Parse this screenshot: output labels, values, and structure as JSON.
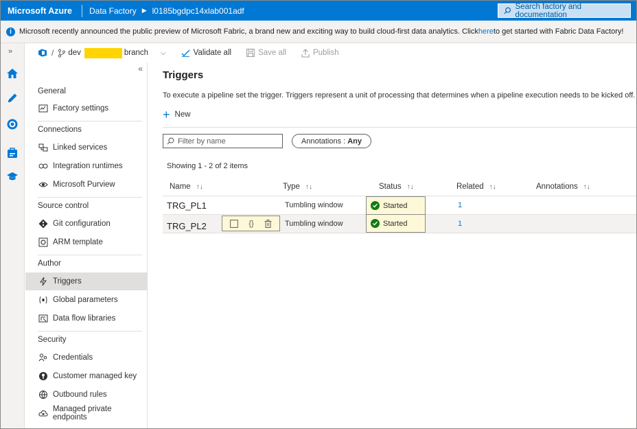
{
  "topbar": {
    "brand": "Microsoft Azure",
    "crumb_service": "Data Factory",
    "crumb_factory": "l0185bgdpc14xlab001adf",
    "search_placeholder": "Search factory and documentation"
  },
  "banner": {
    "text_before": "Microsoft recently announced the public preview of Microsoft Fabric, a brand new and exciting way to build cloud-first data analytics. Click ",
    "link": "here",
    "text_after": " to get started with Fabric Data Factory!"
  },
  "gitbar": {
    "slash": "/",
    "branch_prefix": "dev",
    "branch_suffix": "branch",
    "validate_all": "Validate all",
    "save_all": "Save all",
    "publish": "Publish"
  },
  "sidebar": {
    "sections": {
      "general": "General",
      "connections": "Connections",
      "source_control": "Source control",
      "author": "Author",
      "security": "Security"
    },
    "items": {
      "factory_settings": "Factory settings",
      "linked_services": "Linked services",
      "integration_runtimes": "Integration runtimes",
      "microsoft_purview": "Microsoft Purview",
      "git_configuration": "Git configuration",
      "arm_template": "ARM template",
      "triggers": "Triggers",
      "global_parameters": "Global parameters",
      "data_flow_libraries": "Data flow libraries",
      "credentials": "Credentials",
      "customer_managed_key": "Customer managed key",
      "outbound_rules": "Outbound rules",
      "managed_private_endpoints": "Managed private endpoints"
    }
  },
  "main": {
    "title": "Triggers",
    "description": "To execute a pipeline set the trigger. Triggers represent a unit of processing that determines when a pipeline execution needs to be kicked off.",
    "new_label": "New",
    "filter_placeholder": "Filter by name",
    "annotations_label": "Annotations :",
    "annotations_value": "Any",
    "showing": "Showing 1 - 2 of 2 items",
    "columns": {
      "name": "Name",
      "type": "Type",
      "status": "Status",
      "related": "Related",
      "annotations": "Annotations"
    },
    "rows": [
      {
        "name": "TRG_PL1",
        "type": "Tumbling window",
        "status": "Started",
        "related": "1"
      },
      {
        "name": "TRG_PL2",
        "type": "Tumbling window",
        "status": "Started",
        "related": "1"
      }
    ],
    "row_action_code": "{}"
  },
  "colors": {
    "azure_blue": "#0078d4",
    "highlight": "#ffd400",
    "status_green": "#107c10"
  }
}
